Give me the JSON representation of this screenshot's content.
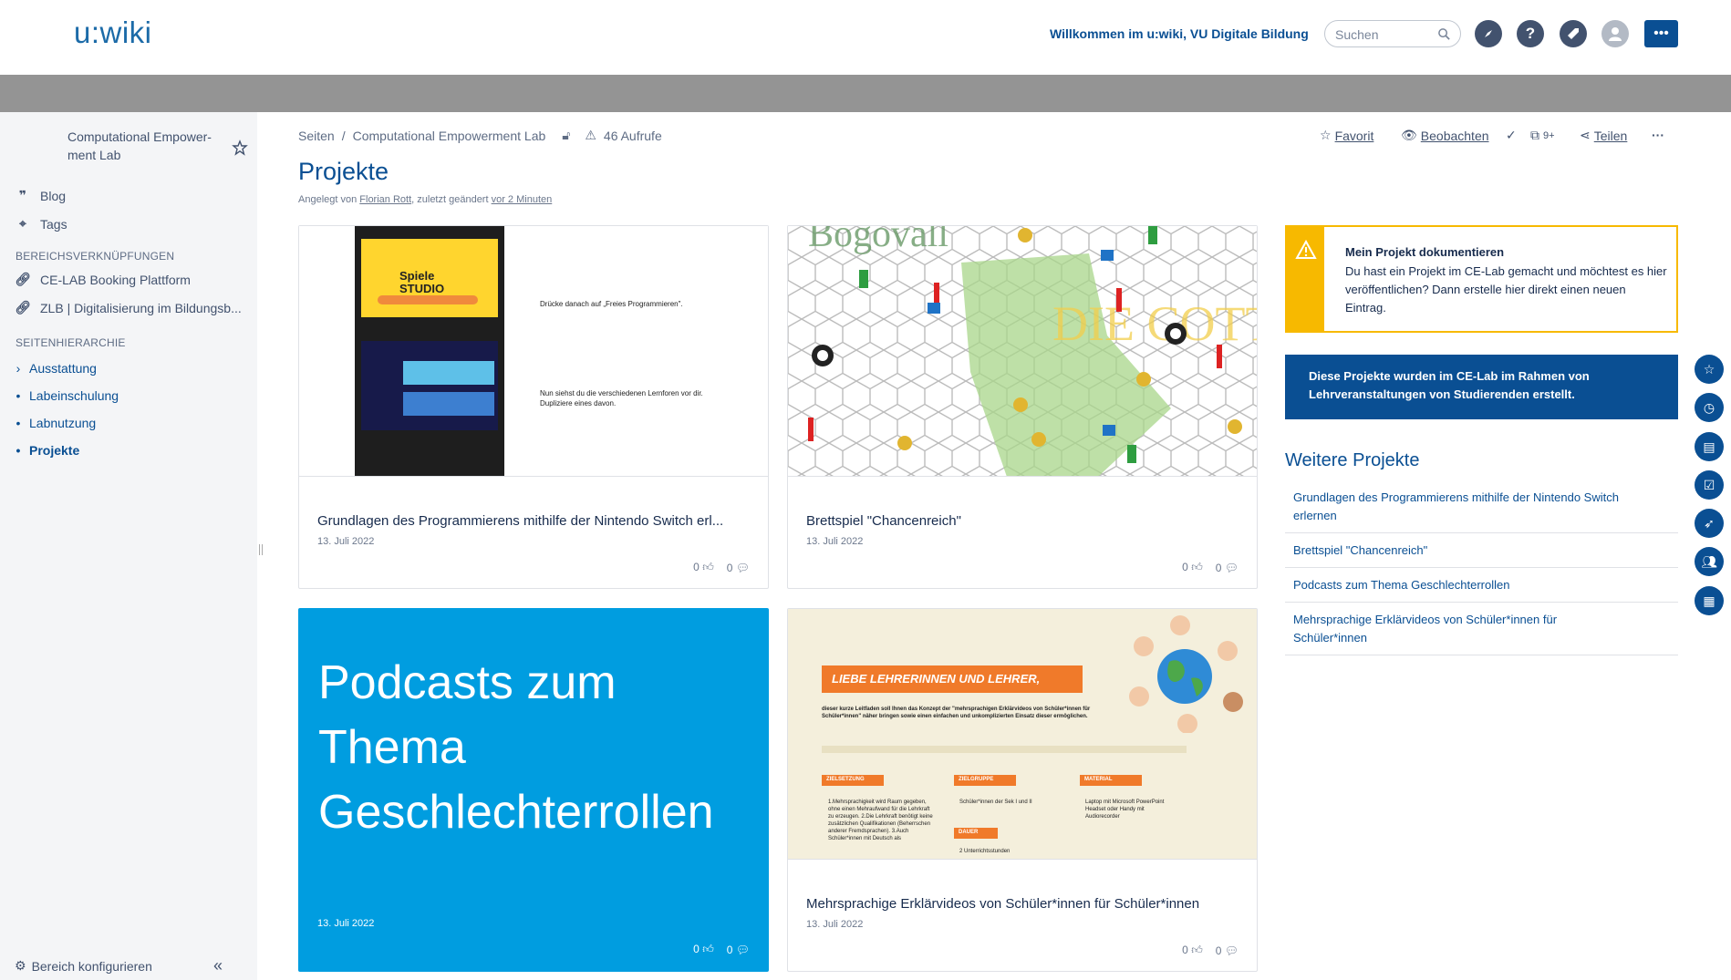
{
  "header": {
    "logo": "u:wiki",
    "welcome": "Willkommen im u:wiki, VU Digitale Bildung",
    "search_placeholder": "Suchen",
    "menu_label": "•••"
  },
  "sidebar": {
    "space_name": "Computational Empower-ment Lab",
    "nav": [
      {
        "label": "Blog",
        "icon": "quote-icon"
      },
      {
        "label": "Tags",
        "icon": "tag-icon"
      }
    ],
    "links_heading": "BEREICHSVERKNÜPFUNGEN",
    "links": [
      {
        "label": "CE-LAB Booking Plattform",
        "icon": "link-icon"
      },
      {
        "label": "ZLB | Digitalisierung im Bildungsb...",
        "icon": "link-icon"
      }
    ],
    "tree_heading": "SEITENHIERARCHIE",
    "tree": [
      {
        "label": "Ausstattung",
        "marker": "›",
        "active": false
      },
      {
        "label": "Labeinschulung",
        "marker": "•",
        "active": false
      },
      {
        "label": "Labnutzung",
        "marker": "•",
        "active": false
      },
      {
        "label": "Projekte",
        "marker": "•",
        "active": true
      }
    ],
    "footer": "Bereich konfigurieren"
  },
  "breadcrumb": {
    "root": "Seiten",
    "sep": "/",
    "parent": "Computational Empowerment Lab",
    "views": "46 Aufrufe"
  },
  "actions": {
    "favorite": "Favorit",
    "watch": "Beobachten",
    "copies_badge": "9+",
    "share": "Teilen"
  },
  "page": {
    "title": "Projekte",
    "byline_prefix": "Angelegt von",
    "author": "Florian Rott",
    "byline_mid": ", zuletzt geändert",
    "modified": "vor 2 Minuten"
  },
  "cards": [
    {
      "title": "Grundlagen des Programmierens mithilfe der Nintendo Switch erl...",
      "date": "13. Juli 2022",
      "likes": "0",
      "comments": "0",
      "thumb_text_1": "Drücke danach auf „Freies Programmieren\".",
      "thumb_text_2": "Nun siehst du die verschiedenen Lernforen vor dir. Dupliziere eines davon.",
      "screen_label": "Spiele STUDIO"
    },
    {
      "title": "Brettspiel \"Chancenreich\"",
      "date": "13. Juli 2022",
      "likes": "0",
      "comments": "0",
      "thumb_text_1": "Bogovall",
      "thumb_text_2": "DIE COTTAGE"
    },
    {
      "title": "Podcasts zum Thema Geschlechterrollen",
      "date": "13. Juli 2022",
      "likes": "0",
      "comments": "0"
    },
    {
      "title": "Mehrsprachige Erklärvideos von Schüler*innen für Schüler*innen",
      "date": "13. Juli 2022",
      "likes": "0",
      "comments": "0",
      "thumb_heading": "LIEBE LEHRERINNEN UND LEHRER,",
      "thumb_text": "dieser kurze Leitfaden soll Ihnen das Konzept der \"mehrsprachigen Erklärvideos von Schüler*innen für Schüler*innen\" näher bringen sowie einen einfachen und unkomplizierten Einsatz dieser ermöglichen.",
      "col_labels": [
        "ZIELSETZUNG",
        "ZIELGRUPPE",
        "MATERIAL",
        "DAUER"
      ],
      "col_texts": [
        "1.Mehrsprachigkeit wird Raum gegeben, ohne einen Mehraufwand für die Lehrkraft zu erzeugen. 2.Die Lehrkraft benötigt keine zusätzlichen Qualifikationen (Beherrschen anderer Fremdsprachen). 3.Auch Schüler*innen mit Deutsch als",
        "Schüler*innen der Sek I und II",
        "Laptop mit Microsoft PowerPoint  Headset oder Handy mit Audiorecorder",
        "2 Unterrichtsstunden"
      ]
    }
  ],
  "info_box": {
    "title": "Mein Projekt dokumentieren",
    "text": "Du hast ein Projekt im CE-Lab gemacht und möchtest es hier veröffentlichen? Dann erstelle hier direkt einen neuen Eintrag."
  },
  "banner": "Diese Projekte wurden im CE-Lab im Rahmen von Lehrveranstaltungen von Studierenden erstellt.",
  "weitere": {
    "title": "Weitere Projekte",
    "items": [
      "Grundlagen des Programmierens mithilfe der Nintendo Switch erlernen",
      "Brettspiel \"Chancenreich\"",
      "Podcasts zum Thema Geschlechterrollen",
      "Mehrsprachige Erklärvideos von Schüler*innen für Schüler*innen"
    ]
  },
  "colors": {
    "brand": "#0a4f93",
    "accent_blue": "#009de0",
    "warning": "#f7b900"
  }
}
